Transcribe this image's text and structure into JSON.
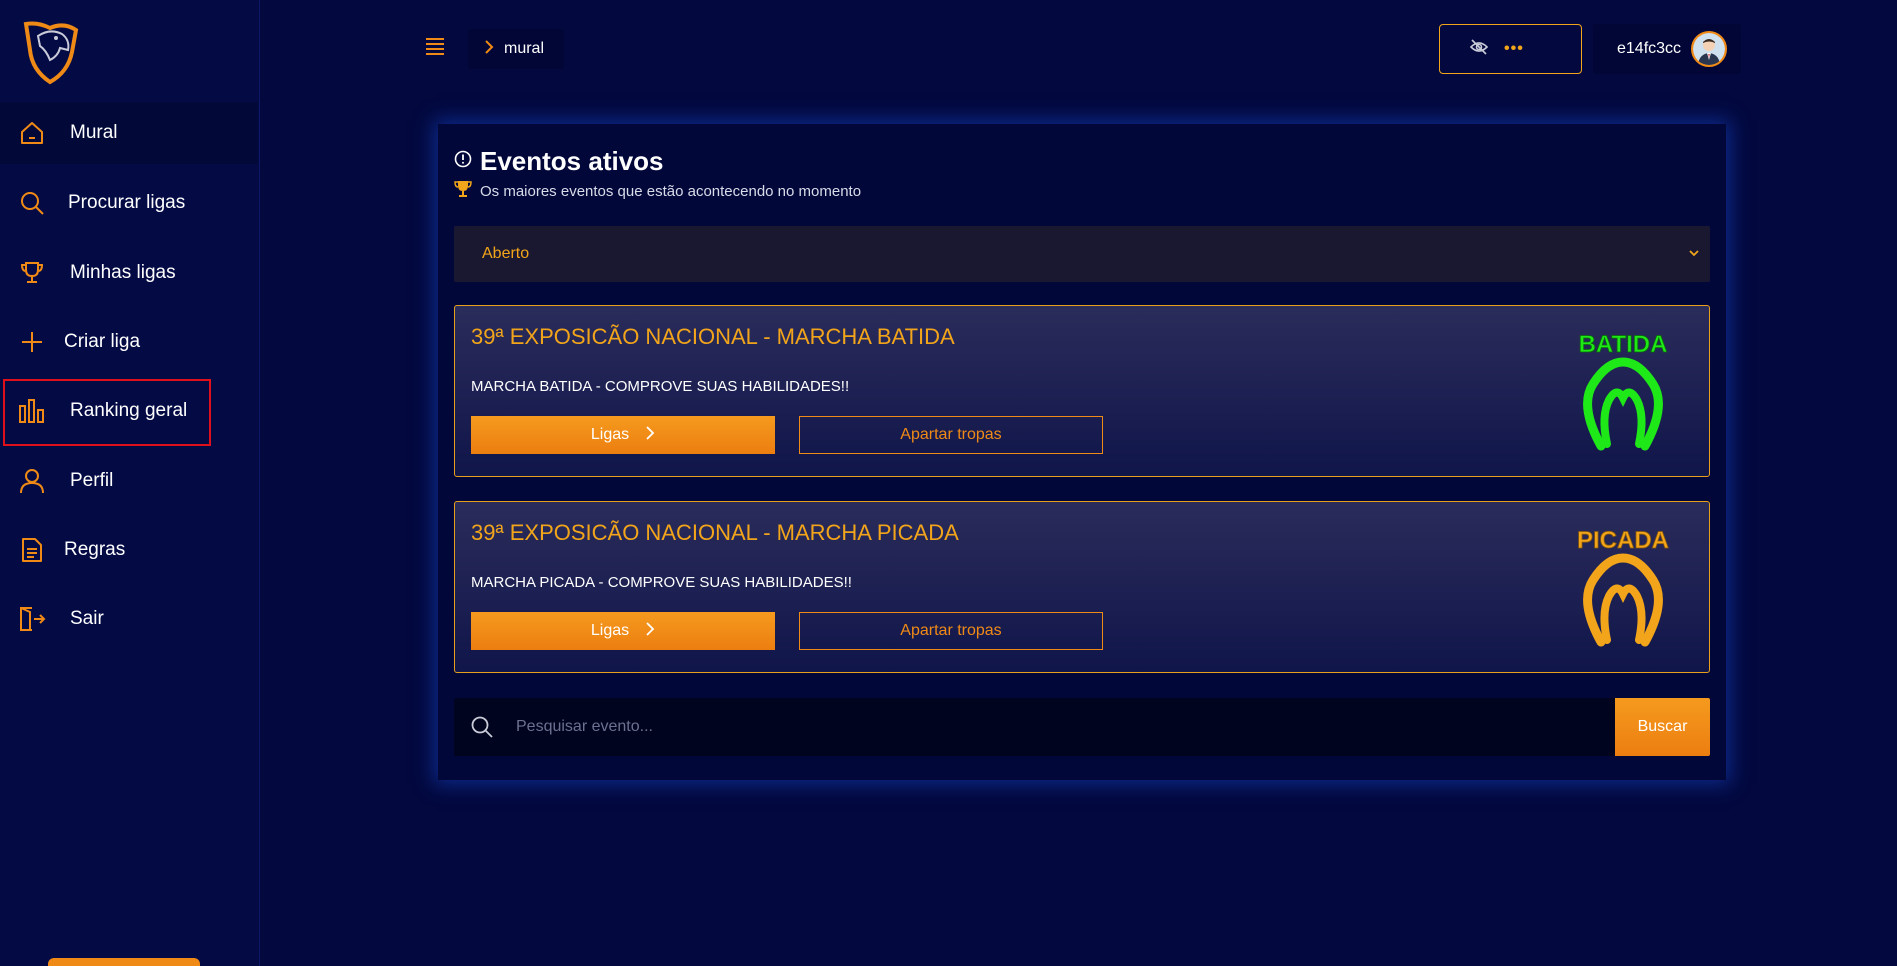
{
  "sidebar": {
    "items": [
      {
        "label": "Mural",
        "icon": "home-icon"
      },
      {
        "label": "Procurar ligas",
        "icon": "search-icon"
      },
      {
        "label": "Minhas ligas",
        "icon": "trophy-icon"
      },
      {
        "label": "Criar liga",
        "icon": "plus-icon"
      },
      {
        "label": "Ranking geral",
        "icon": "bar-chart-icon"
      },
      {
        "label": "Perfil",
        "icon": "user-icon"
      },
      {
        "label": "Regras",
        "icon": "document-icon"
      },
      {
        "label": "Sair",
        "icon": "logout-icon"
      }
    ]
  },
  "header": {
    "breadcrumb": "mural",
    "balance_hidden": "•••",
    "username": "e14fc3cc"
  },
  "main": {
    "title": "Eventos ativos",
    "subtitle": "Os maiores eventos que estão acontecendo no momento",
    "filter": {
      "selected": "Aberto"
    },
    "events": [
      {
        "title": "39ª EXPOSICÃO NACIONAL - MARCHA BATIDA",
        "description": "MARCHA BATIDA - COMPROVE SUAS HABILIDADES!!",
        "ligas_label": "Ligas",
        "apartar_label": "Apartar tropas",
        "logo_text": "BATIDA",
        "logo_color": "#1ee818"
      },
      {
        "title": "39ª EXPOSICÃO NACIONAL - MARCHA PICADA",
        "description": "MARCHA PICADA - COMPROVE SUAS HABILIDADES!!",
        "ligas_label": "Ligas",
        "apartar_label": "Apartar tropas",
        "logo_text": "PICADA",
        "logo_color": "#f2a51a"
      }
    ],
    "search": {
      "placeholder": "Pesquisar evento...",
      "button_label": "Buscar"
    }
  },
  "colors": {
    "background": "#03093f",
    "accent": "#f08a16",
    "highlight_border": "#e0101a"
  }
}
